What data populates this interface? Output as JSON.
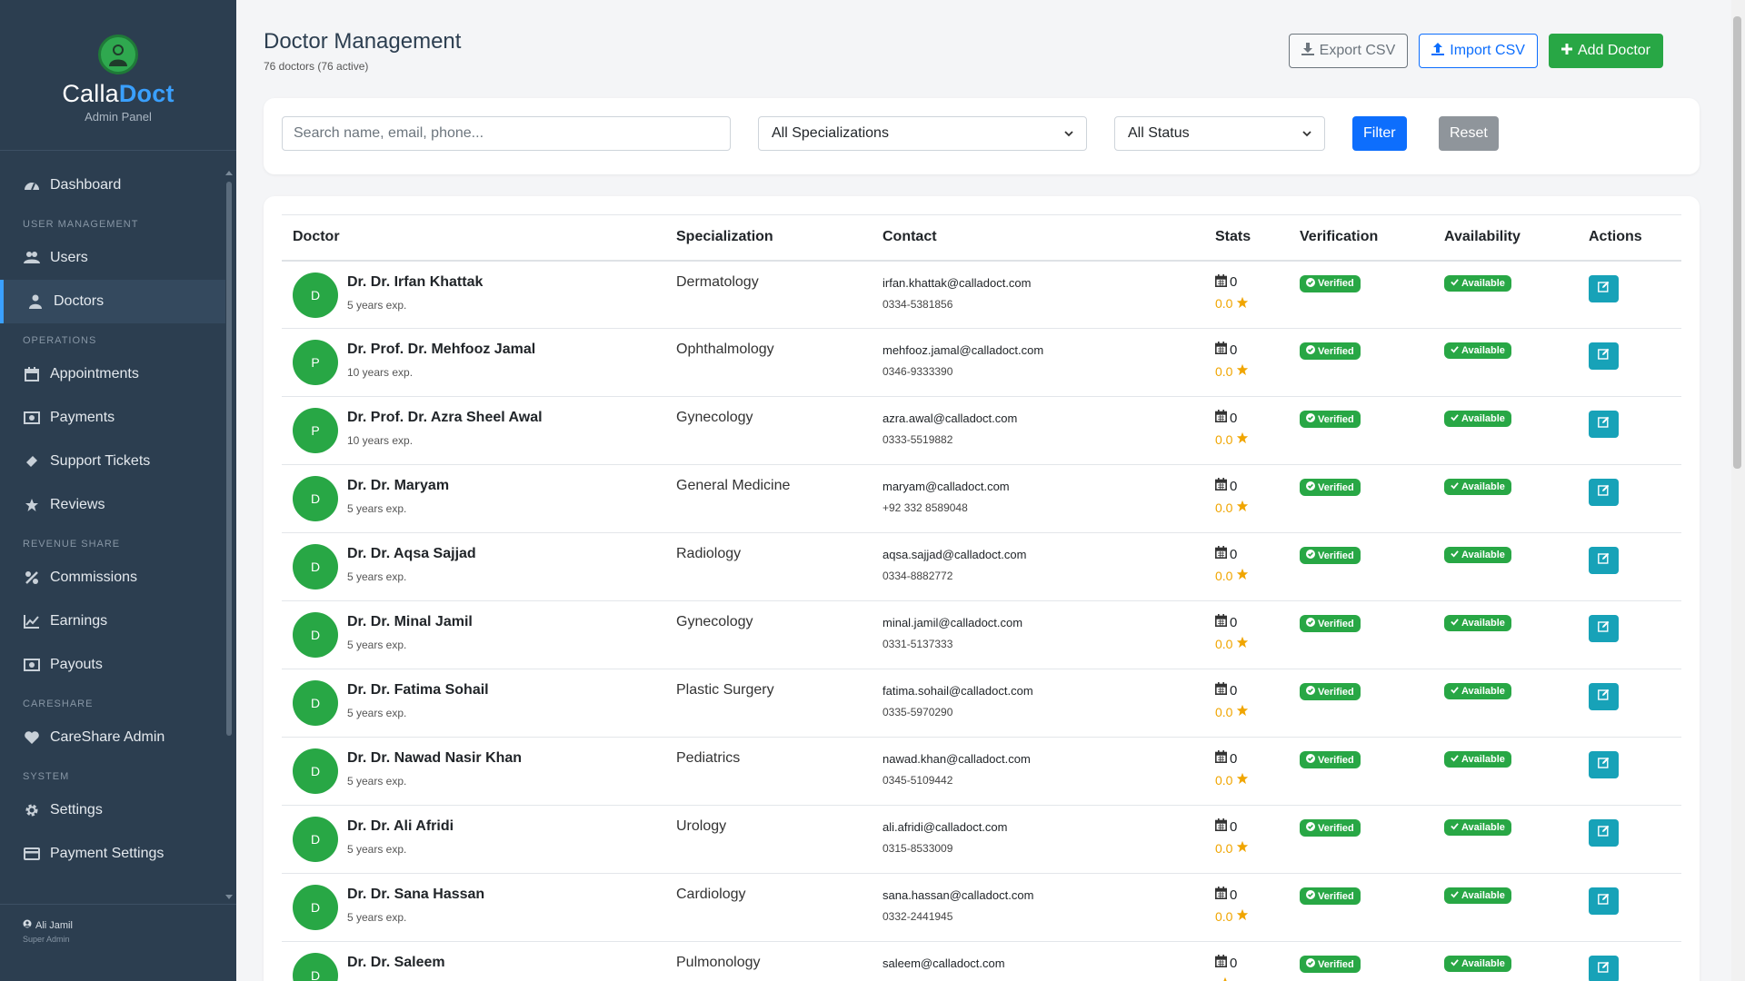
{
  "sidebar": {
    "brand_first": "Calla",
    "brand_second": "Doct",
    "brand_sub": "Admin Panel",
    "sections": {
      "dashboard": "Dashboard",
      "user_mgmt": "USER MANAGEMENT",
      "users": "Users",
      "doctors": "Doctors",
      "operations": "OPERATIONS",
      "appointments": "Appointments",
      "payments": "Payments",
      "support": "Support Tickets",
      "reviews": "Reviews",
      "revenue": "REVENUE SHARE",
      "commissions": "Commissions",
      "earnings": "Earnings",
      "payouts": "Payouts",
      "careshare": "CARESHARE",
      "careshare_admin": "CareShare Admin",
      "system": "SYSTEM",
      "settings": "Settings",
      "payment_settings": "Payment Settings"
    },
    "user": "Ali Jamil",
    "role": "Super Admin"
  },
  "header": {
    "title": "Doctor Management",
    "subtitle": "76 doctors (76 active)",
    "export": "Export CSV",
    "import": "Import CSV",
    "add": "Add Doctor"
  },
  "filters": {
    "search_placeholder": "Search name, email, phone...",
    "specialization": "All Specializations",
    "status": "All Status",
    "filter": "Filter",
    "reset": "Reset"
  },
  "table": {
    "headers": [
      "Doctor",
      "Specialization",
      "Contact",
      "Stats",
      "Verification",
      "Availability",
      "Actions"
    ],
    "rows": [
      {
        "initial": "D",
        "name": "Dr. Dr. Irfan Khattak",
        "exp": "5 years exp.",
        "spec": "Dermatology",
        "email": "irfan.khattak@calladoct.com",
        "phone": "0334-5381856",
        "appts": "0",
        "rating": "0.0",
        "verify": "Verified",
        "avail": "Available"
      },
      {
        "initial": "P",
        "name": "Dr. Prof. Dr. Mehfooz Jamal",
        "exp": "10 years exp.",
        "spec": "Ophthalmology",
        "email": "mehfooz.jamal@calladoct.com",
        "phone": "0346-9333390",
        "appts": "0",
        "rating": "0.0",
        "verify": "Verified",
        "avail": "Available"
      },
      {
        "initial": "P",
        "name": "Dr. Prof. Dr. Azra Sheel Awal",
        "exp": "10 years exp.",
        "spec": "Gynecology",
        "email": "azra.awal@calladoct.com",
        "phone": "0333-5519882",
        "appts": "0",
        "rating": "0.0",
        "verify": "Verified",
        "avail": "Available"
      },
      {
        "initial": "D",
        "name": "Dr. Dr. Maryam",
        "exp": "5 years exp.",
        "spec": "General Medicine",
        "email": "maryam@calladoct.com",
        "phone": "+92 332 8589048",
        "appts": "0",
        "rating": "0.0",
        "verify": "Verified",
        "avail": "Available"
      },
      {
        "initial": "D",
        "name": "Dr. Dr. Aqsa Sajjad",
        "exp": "5 years exp.",
        "spec": "Radiology",
        "email": "aqsa.sajjad@calladoct.com",
        "phone": "0334-8882772",
        "appts": "0",
        "rating": "0.0",
        "verify": "Verified",
        "avail": "Available"
      },
      {
        "initial": "D",
        "name": "Dr. Dr. Minal Jamil",
        "exp": "5 years exp.",
        "spec": "Gynecology",
        "email": "minal.jamil@calladoct.com",
        "phone": "0331-5137333",
        "appts": "0",
        "rating": "0.0",
        "verify": "Verified",
        "avail": "Available"
      },
      {
        "initial": "D",
        "name": "Dr. Dr. Fatima Sohail",
        "exp": "5 years exp.",
        "spec": "Plastic Surgery",
        "email": "fatima.sohail@calladoct.com",
        "phone": "0335-5970290",
        "appts": "0",
        "rating": "0.0",
        "verify": "Verified",
        "avail": "Available"
      },
      {
        "initial": "D",
        "name": "Dr. Dr. Nawad Nasir Khan",
        "exp": "5 years exp.",
        "spec": "Pediatrics",
        "email": "nawad.khan@calladoct.com",
        "phone": "0345-5109442",
        "appts": "0",
        "rating": "0.0",
        "verify": "Verified",
        "avail": "Available"
      },
      {
        "initial": "D",
        "name": "Dr. Dr. Ali Afridi",
        "exp": "5 years exp.",
        "spec": "Urology",
        "email": "ali.afridi@calladoct.com",
        "phone": "0315-8533009",
        "appts": "0",
        "rating": "0.0",
        "verify": "Verified",
        "avail": "Available"
      },
      {
        "initial": "D",
        "name": "Dr. Dr. Sana Hassan",
        "exp": "5 years exp.",
        "spec": "Cardiology",
        "email": "sana.hassan@calladoct.com",
        "phone": "0332-2441945",
        "appts": "0",
        "rating": "0.0",
        "verify": "Verified",
        "avail": "Available"
      },
      {
        "initial": "D",
        "name": "Dr. Dr. Saleem",
        "exp": "",
        "spec": "Pulmonology",
        "email": "saleem@calladoct.com",
        "phone": "",
        "appts": "0",
        "rating": "",
        "verify": "Verified",
        "avail": "Available"
      }
    ]
  },
  "colors": {
    "sidebar_bg": "#2c3e50",
    "accent_blue": "#0d6efd",
    "success_green": "#28a745",
    "info_teal": "#17a2b8",
    "star_gold": "#f0a500"
  }
}
